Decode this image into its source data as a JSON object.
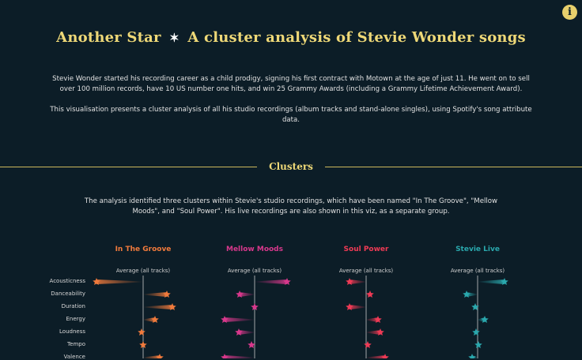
{
  "title": {
    "part1": "Another Star",
    "star": "✶",
    "part2": "A cluster analysis of Stevie Wonder songs"
  },
  "intro": {
    "p1": "Stevie Wonder started his recording career as a child prodigy, signing his first contract with Motown at the age of just 11. He went on to sell over 100 million records, have 10 US number one hits, and win 25 Grammy Awards (including a Grammy Lifetime Achievement Award).",
    "p2": "This visualisation presents a cluster analysis of all his studio recordings (album tracks and stand-alone singles), using Spotify's song attribute data."
  },
  "section": {
    "title": "Clusters",
    "text": "The analysis identified three clusters within Stevie's studio recordings, which have been named  \"In The Groove\", \"Mellow Moods\", and \"Soul Power\". His live recordings are also shown in this viz, as a separate group."
  },
  "info_icon": "info-icon",
  "avg_label": "Average (all tracks)",
  "attributes": [
    "Acousticness",
    "Danceability",
    "Duration",
    "Energy",
    "Loudness",
    "Tempo",
    "Valence"
  ],
  "clusters": [
    {
      "name": "In The Groove",
      "color": "#f07a3c",
      "deviations": [
        -59,
        30,
        37,
        15,
        -2,
        0,
        21
      ]
    },
    {
      "name": "Mellow Moods",
      "color": "#d8388c",
      "deviations": [
        41,
        -19,
        0,
        -38,
        -20,
        -4,
        -38
      ]
    },
    {
      "name": "Soul Power",
      "color": "#ef3a55",
      "deviations": [
        -21,
        5,
        -21,
        15,
        18,
        2,
        24
      ]
    },
    {
      "name": "Stevie Live",
      "color": "#2aa8ad",
      "deviations": [
        34,
        -14,
        -3,
        9,
        -2,
        1,
        -7
      ]
    }
  ]
}
